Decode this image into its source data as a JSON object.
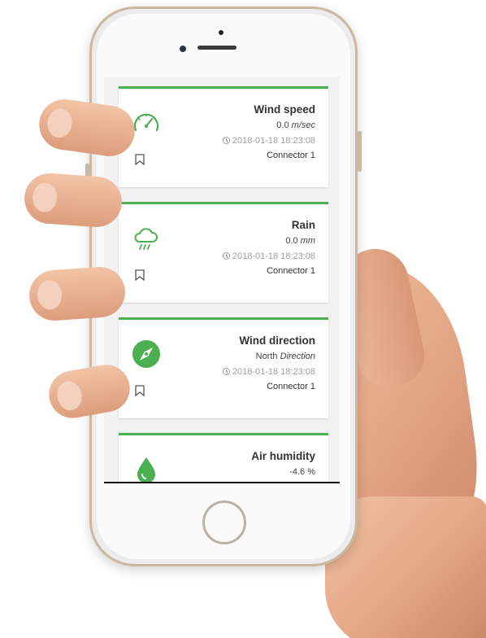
{
  "cards": [
    {
      "title": "Wind speed",
      "value": "0.0",
      "unit": "m/sec",
      "timestamp": "2018-01-18 18:23:08",
      "connector": "Connector 1",
      "icon": "speedometer-icon"
    },
    {
      "title": "Rain",
      "value": "0.0",
      "unit": "mm",
      "timestamp": "2018-01-18 18:23:08",
      "connector": "Connector 1",
      "icon": "rain-cloud-icon"
    },
    {
      "title": "Wind direction",
      "value": "North",
      "unit": "Direction",
      "timestamp": "2018-01-18 18:23:08",
      "connector": "Connector 1",
      "icon": "compass-icon"
    },
    {
      "title": "Air humidity",
      "value": "-4.6 %",
      "icon": "water-drop-icon"
    }
  ],
  "colors": {
    "accent": "#4caf50",
    "card_bg": "#ffffff",
    "screen_bg": "#f2f2f2"
  }
}
